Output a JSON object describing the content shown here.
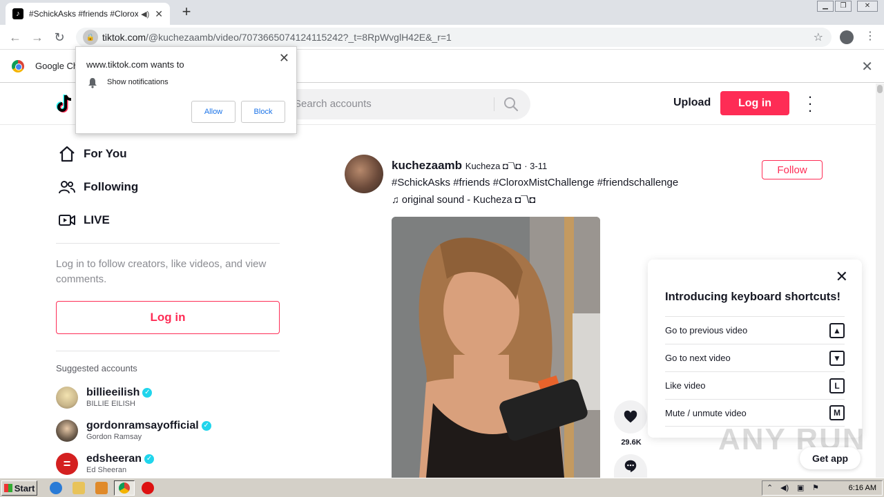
{
  "browser": {
    "tab_title": "#SchickAsks #friends #CloroxM",
    "url_host": "tiktok.com",
    "url_path": "/@kuchezaamb/video/7073665074124115242?_t=8RpWvglH42E&_r=1",
    "infobar_text": "Google Ch"
  },
  "permission": {
    "title": "www.tiktok.com wants to",
    "item": "Show notifications",
    "allow": "Allow",
    "block": "Block"
  },
  "header": {
    "search_placeholder": "Search accounts",
    "upload": "Upload",
    "login": "Log in"
  },
  "sidebar": {
    "nav": [
      {
        "label": "For You",
        "icon": "home-icon"
      },
      {
        "label": "Following",
        "icon": "users-icon"
      },
      {
        "label": "LIVE",
        "icon": "live-icon"
      }
    ],
    "prompt": "Log in to follow creators, like videos, and view comments.",
    "login": "Log in",
    "suggested_title": "Suggested accounts",
    "accounts": [
      {
        "username": "billieeilish",
        "display": "BILLIE EILISH"
      },
      {
        "username": "gordonramsayofficial",
        "display": "Gordon Ramsay"
      },
      {
        "username": "edsheeran",
        "display": "Ed Sheeran"
      }
    ]
  },
  "post": {
    "username": "kuchezaamb",
    "nickname": "Kucheza ◘¯\\◘",
    "date": "· 3-11",
    "caption": "#SchickAsks #friends #CloroxMistChallenge #friendschallenge",
    "music": "original sound - Kucheza ◘¯\\◘",
    "follow": "Follow",
    "likes": "29.6K"
  },
  "shortcuts": {
    "title": "Introducing keyboard shortcuts!",
    "rows": [
      {
        "label": "Go to previous video",
        "key": "▲"
      },
      {
        "label": "Go to next video",
        "key": "▼"
      },
      {
        "label": "Like video",
        "key": "L"
      },
      {
        "label": "Mute / unmute video",
        "key": "M"
      }
    ]
  },
  "get_app": "Get app",
  "watermark": "ANY RUN",
  "taskbar": {
    "start": "Start",
    "clock": "6:16 AM"
  }
}
